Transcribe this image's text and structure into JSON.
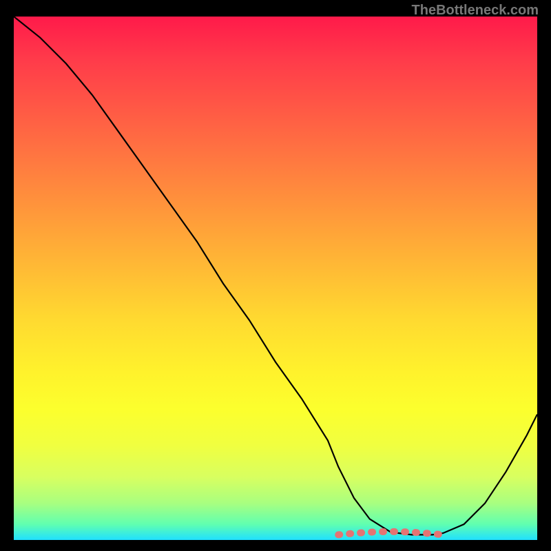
{
  "watermark": "TheBottleneck.com",
  "chart_data": {
    "type": "line",
    "title": "",
    "xlabel": "",
    "ylabel": "",
    "xlim": [
      0,
      100
    ],
    "ylim": [
      0,
      100
    ],
    "grid": false,
    "legend": false,
    "series": [
      {
        "name": "curve",
        "x": [
          0,
          5,
          10,
          15,
          20,
          25,
          30,
          35,
          40,
          45,
          50,
          55,
          60,
          62,
          65,
          68,
          72,
          76,
          80,
          82,
          86,
          90,
          94,
          98,
          100
        ],
        "y": [
          100,
          96,
          91,
          85,
          78,
          71,
          64,
          57,
          49,
          42,
          34,
          27,
          19,
          14,
          8,
          4,
          1.5,
          1,
          1,
          1.3,
          3,
          7,
          13,
          20,
          24
        ]
      },
      {
        "name": "highlight-flat-region",
        "x": [
          62,
          82
        ],
        "y": [
          1.2,
          1.2
        ]
      }
    ],
    "annotations": []
  }
}
